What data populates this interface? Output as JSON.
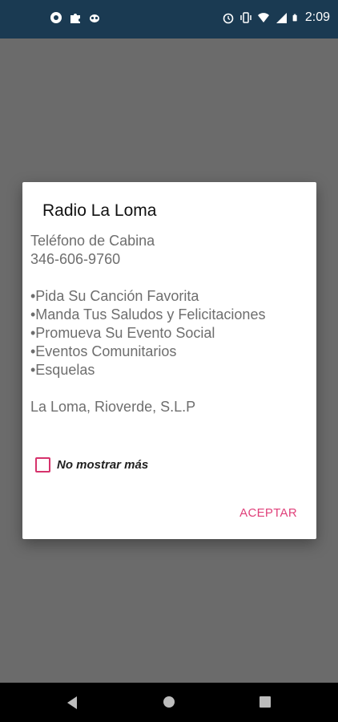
{
  "status_bar": {
    "time": "2:09",
    "left_icons": [
      "chrome-icon",
      "puzzle-icon",
      "owl-icon"
    ],
    "right_icons": [
      "alarm-icon",
      "vibrate-icon",
      "wifi-icon",
      "signal-icon",
      "battery-icon"
    ]
  },
  "dialog": {
    "title": "Radio La Loma",
    "phone_label": "Teléfono de Cabina",
    "phone_number": "346-606-9760",
    "services": [
      "•Pida Su Canción Favorita",
      "•Manda Tus Saludos y Felicitaciones",
      "•Promueva Su Evento Social",
      "•Eventos Comunitarios",
      "•Esquelas"
    ],
    "location": "La Loma, Rioverde, S.L.P",
    "checkbox_label": "No mostrar más",
    "checkbox_checked": false,
    "accept_label": "ACEPTAR",
    "accent_color": "#e0407a"
  },
  "nav_bar": {
    "buttons": [
      "back-icon",
      "home-icon",
      "recents-icon"
    ]
  }
}
